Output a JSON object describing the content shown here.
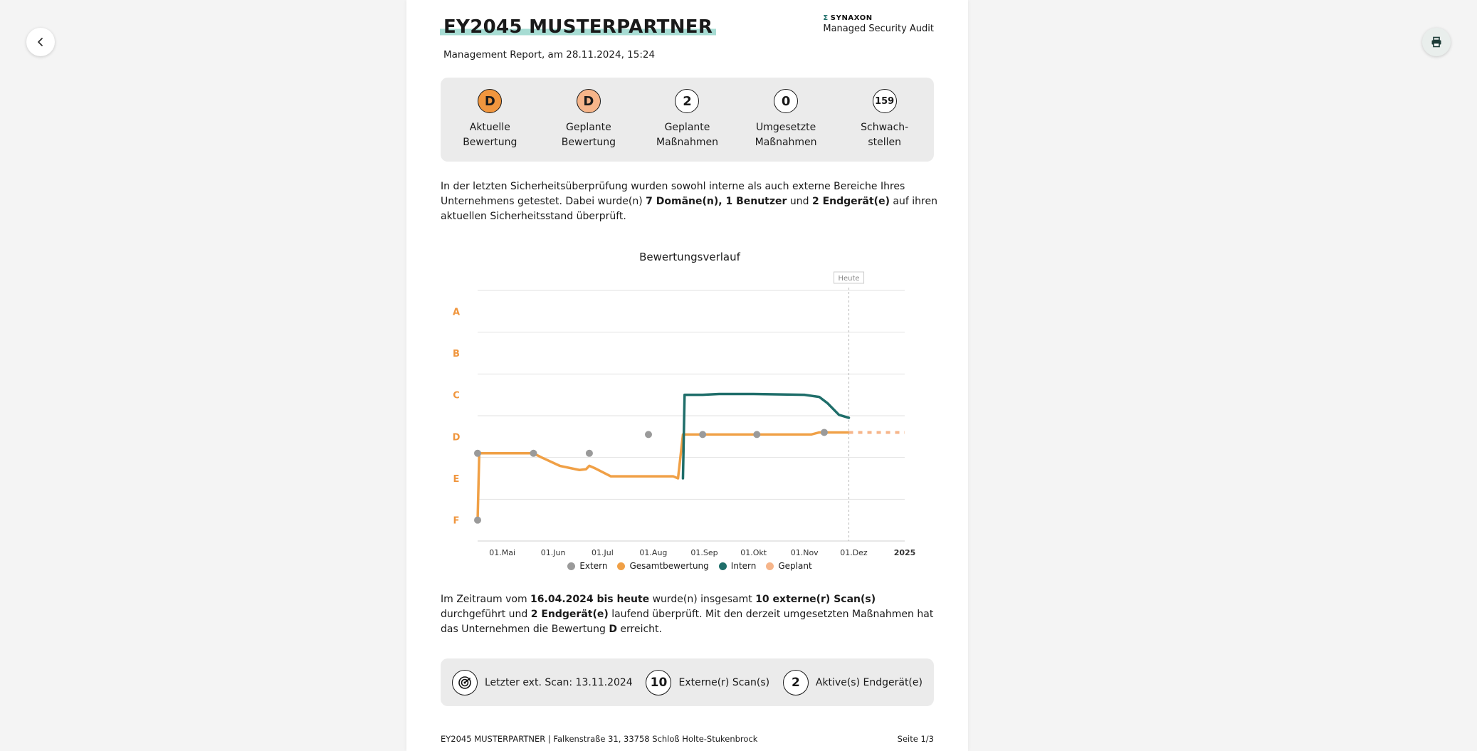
{
  "report": {
    "title": "EY2045 MUSTERPARTNER",
    "subtitle": "Management Report, am 28.11.2024, 15:24",
    "brand_name": "SYNAXON",
    "brand_subtitle": "Managed Security Audit"
  },
  "kpis": [
    {
      "value": "D",
      "label": "Aktuelle\nBewertung",
      "color": "#f0963e"
    },
    {
      "value": "D",
      "label": "Geplante\nBewertung",
      "color": "#f6b58a"
    },
    {
      "value": "2",
      "label": "Geplante\nMaßnahmen",
      "color": "#ffffff"
    },
    {
      "value": "0",
      "label": "Umgesetzte\nMaßnahmen",
      "color": "#ffffff"
    },
    {
      "value": "159",
      "label": "Schwach-\nstellen",
      "color": "#ffffff"
    }
  ],
  "intro": {
    "t1": "In der letzten Sicherheitsüberprüfung wurden sowohl interne als auch externe Bereiche Ihres Unternehmens getestet. Dabei wurde(n) ",
    "b1": "7 Domäne(n), 1 Benutzer",
    "t2": " und ",
    "b2": "2 Endgerät(e)",
    "t3": " auf ihren aktuellen Sicherheitsstand überprüft."
  },
  "chart_data": {
    "type": "line",
    "title": "Bewertungsverlauf",
    "y_categories": [
      "A",
      "B",
      "C",
      "D",
      "E",
      "F"
    ],
    "x_ticks": [
      "01.Mai",
      "01.Jun",
      "01.Jul",
      "01.Aug",
      "01.Sep",
      "01.Okt",
      "01.Nov",
      "01.Dez",
      "2025"
    ],
    "x_range": [
      "2024-04-16",
      "2025-01-01"
    ],
    "today_label": "Heute",
    "today": "2024-11-28",
    "series": [
      {
        "name": "Extern",
        "color": "#9a9a9a",
        "kind": "points",
        "points": [
          [
            "2024-04-16",
            5.0
          ],
          [
            "2024-04-16",
            3.4
          ],
          [
            "2024-05-20",
            3.4
          ],
          [
            "2024-06-23",
            3.4
          ],
          [
            "2024-07-29",
            2.95
          ],
          [
            "2024-08-31",
            2.95
          ],
          [
            "2024-10-03",
            2.95
          ],
          [
            "2024-11-13",
            2.9
          ]
        ]
      },
      {
        "name": "Gesamtbewertung",
        "color": "#f0a046",
        "kind": "line",
        "points": [
          [
            "2024-04-16",
            5.0
          ],
          [
            "2024-04-17",
            3.4
          ],
          [
            "2024-05-20",
            3.4
          ],
          [
            "2024-05-25",
            3.5
          ],
          [
            "2024-06-05",
            3.7
          ],
          [
            "2024-06-17",
            3.8
          ],
          [
            "2024-06-21",
            3.78
          ],
          [
            "2024-06-23",
            3.7
          ],
          [
            "2024-06-26",
            3.75
          ],
          [
            "2024-07-06",
            3.95
          ],
          [
            "2024-08-13",
            3.95
          ],
          [
            "2024-08-16",
            4.0
          ],
          [
            "2024-08-19",
            2.95
          ],
          [
            "2024-11-05",
            2.95
          ],
          [
            "2024-11-10",
            2.9
          ],
          [
            "2024-11-28",
            2.9
          ]
        ]
      },
      {
        "name": "Intern",
        "color": "#1f6e6a",
        "kind": "line",
        "points": [
          [
            "2024-08-19",
            4.0
          ],
          [
            "2024-08-20",
            2.0
          ],
          [
            "2024-08-31",
            2.0
          ],
          [
            "2024-09-10",
            1.98
          ],
          [
            "2024-10-01",
            1.98
          ],
          [
            "2024-11-01",
            2.0
          ],
          [
            "2024-11-10",
            2.05
          ],
          [
            "2024-11-15",
            2.2
          ],
          [
            "2024-11-22",
            2.48
          ],
          [
            "2024-11-28",
            2.55
          ]
        ]
      },
      {
        "name": "Geplant",
        "color": "#f6b58a",
        "kind": "dotted",
        "points": [
          [
            "2024-11-28",
            2.9
          ],
          [
            "2025-01-01",
            2.9
          ]
        ]
      }
    ]
  },
  "summary": {
    "t1": "Im Zeitraum vom ",
    "b1": "16.04.2024 bis heute",
    "t2": " wurde(n) insgesamt ",
    "b2": "10 externe(r) Scan(s)",
    "t3": " durchgeführt und ",
    "b3": "2 Endgerät(e)",
    "t4": " laufend überprüft. Mit den derzeit umgesetzten Maßnahmen hat das Unternehmen die Bewertung ",
    "b4": "D",
    "t5": " erreicht."
  },
  "stats": {
    "last_scan": "Letzter ext. Scan: 13.11.2024",
    "scan_count": "10",
    "scan_label": "Externe(r) Scan(s)",
    "device_count": "2",
    "device_label": "Aktive(s) Endgerät(e)"
  },
  "footer": {
    "address": "EY2045 MUSTERPARTNER | Falkenstraße 31, 33758 Schloß Holte-Stukenbrock",
    "page": "Seite 1/3"
  },
  "icons": {
    "back": "chevron-left-icon",
    "print": "printer-icon",
    "scan": "radar-icon"
  }
}
